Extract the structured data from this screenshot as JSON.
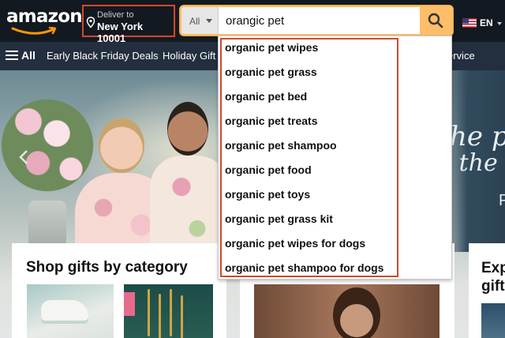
{
  "header": {
    "logo_text": "amazon",
    "deliver": {
      "line1": "Deliver to",
      "line2": "New York 10001"
    },
    "search": {
      "category": "All",
      "query": "orangic pet"
    },
    "language": "EN"
  },
  "subnav": {
    "all_label": "All",
    "links": [
      "Early Black Friday Deals",
      "Holiday Gift",
      "ervice"
    ]
  },
  "hero": {
    "script_line1": "he peop",
    "script_line2": "t the V",
    "trailing_letter": "P"
  },
  "cards": {
    "card1_title": "Shop gifts by category",
    "card3_title": "Exp gift"
  },
  "suggestions": [
    "organic pet wipes",
    "organic pet grass",
    "organic pet bed",
    "organic pet treats",
    "organic pet shampoo",
    "organic pet food",
    "organic pet toys",
    "organic pet grass kit",
    "organic pet wipes for dogs",
    "organic pet shampoo for dogs"
  ],
  "colors": {
    "nav_bg": "#131921",
    "subnav_bg": "#232f3e",
    "accent": "#febd69",
    "highlight": "#d2492a"
  }
}
